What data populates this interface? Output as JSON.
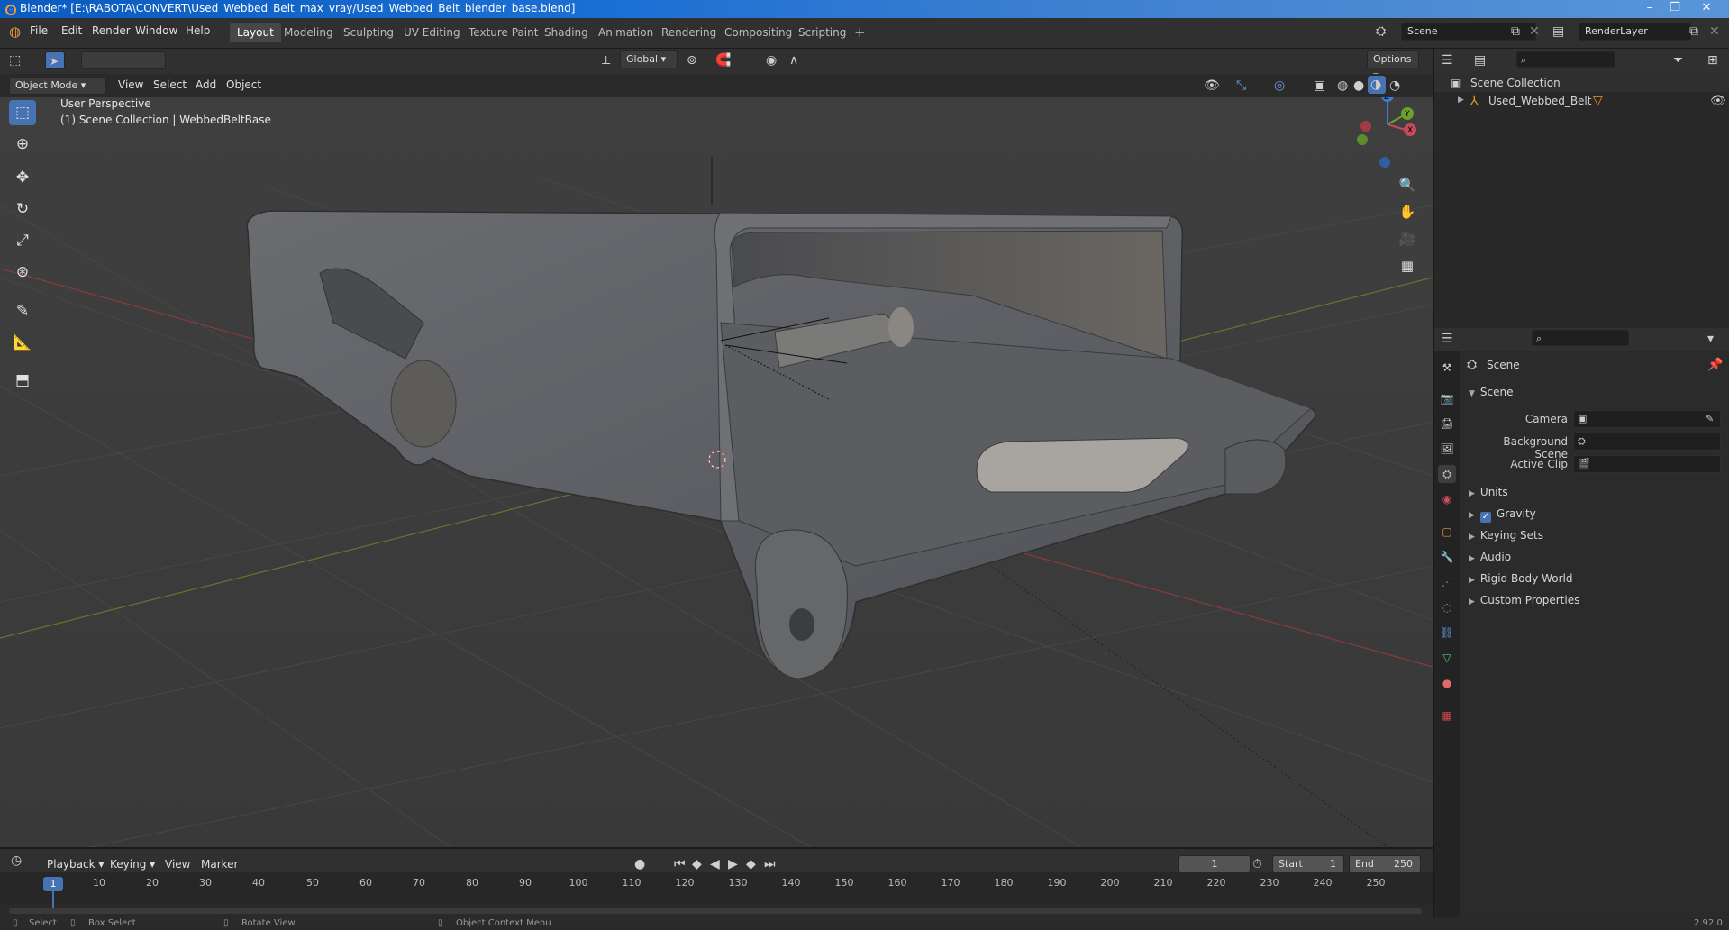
{
  "window": {
    "title": "Blender* [E:\\RABOTA\\CONVERT\\Used_Webbed_Belt_max_vray/Used_Webbed_Belt_blender_base.blend]"
  },
  "menu": [
    "File",
    "Edit",
    "Render",
    "Window",
    "Help"
  ],
  "workspaces": [
    "Layout",
    "Modeling",
    "Sculpting",
    "UV Editing",
    "Texture Paint",
    "Shading",
    "Animation",
    "Rendering",
    "Compositing",
    "Scripting"
  ],
  "active_workspace": "Layout",
  "topbar": {
    "scene": "Scene",
    "view_layer": "RenderLayer"
  },
  "viewport_header": {
    "transform_orientation": "Global",
    "options": "Options",
    "mode": "Object Mode",
    "menus": [
      "View",
      "Select",
      "Add",
      "Object"
    ]
  },
  "viewport": {
    "perspective": "User Perspective",
    "collection_info": "(1) Scene Collection | WebbedBeltBase"
  },
  "gizmo": {
    "z": "Z",
    "x": "X",
    "y": "Y"
  },
  "outliner": {
    "root": "Scene Collection",
    "items": [
      {
        "label": "Used_Webbed_Belt"
      }
    ]
  },
  "properties": {
    "context": "Scene",
    "section": "Scene",
    "fields": [
      {
        "label": "Camera"
      },
      {
        "label": "Background Scene"
      },
      {
        "label": "Active Clip"
      }
    ],
    "panels": [
      {
        "label": "Units",
        "checkbox": false
      },
      {
        "label": "Gravity",
        "checkbox": true
      },
      {
        "label": "Keying Sets",
        "checkbox": false
      },
      {
        "label": "Audio",
        "checkbox": false
      },
      {
        "label": "Rigid Body World",
        "checkbox": false
      },
      {
        "label": "Custom Properties",
        "checkbox": false
      }
    ]
  },
  "timeline": {
    "menus": [
      "Playback",
      "Keying",
      "View",
      "Marker"
    ],
    "current_frame": "1",
    "start_label": "Start",
    "start": "1",
    "end_label": "End",
    "end": "250",
    "ticks": [
      "1",
      "10",
      "20",
      "30",
      "40",
      "50",
      "60",
      "70",
      "80",
      "90",
      "100",
      "110",
      "120",
      "130",
      "140",
      "150",
      "160",
      "170",
      "180",
      "190",
      "200",
      "210",
      "220",
      "230",
      "240",
      "250"
    ]
  },
  "statusbar": {
    "select": "Select",
    "box_select": "Box Select",
    "rotate": "Rotate View",
    "context_menu": "Object Context Menu",
    "version": "2.92.0"
  }
}
